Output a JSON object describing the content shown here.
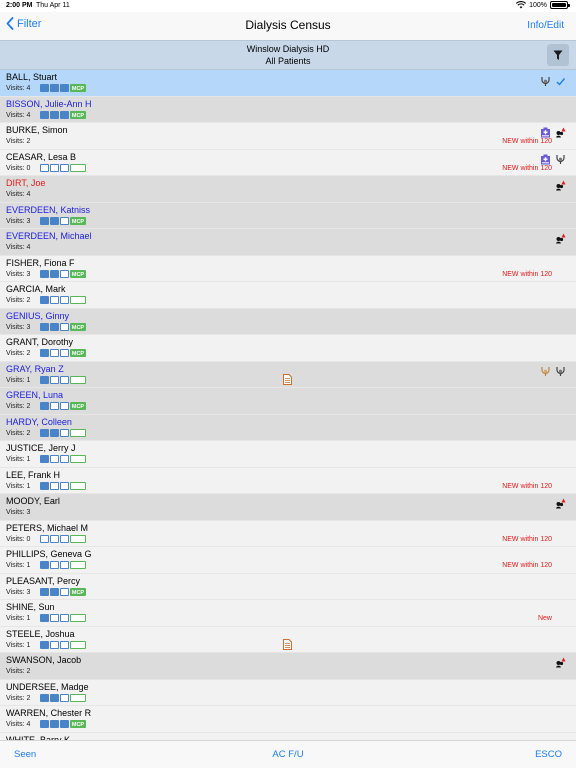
{
  "status_bar": {
    "time": "2:00 PM",
    "date": "Thu Apr 11",
    "battery": "100%"
  },
  "nav": {
    "back_label": "Filter",
    "title": "Dialysis Census",
    "right_label": "Info/Edit"
  },
  "header": {
    "facility": "Winslow Dialysis HD",
    "subtitle": "All Patients"
  },
  "patients": [
    {
      "name": "BALL, Stuart",
      "visits": "Visits: 4",
      "color": "c-black",
      "bg": "selected",
      "boxes": [
        1,
        1,
        1
      ],
      "mcp": "filled",
      "note": "",
      "doc": false,
      "icons": [
        "stethoscope-icon",
        "checkmark-icon"
      ]
    },
    {
      "name": "BISSON, Julie-Ann H",
      "visits": "Visits: 4",
      "color": "c-blue",
      "bg": "shaded",
      "boxes": [
        1,
        1,
        1
      ],
      "mcp": "filled",
      "note": "",
      "doc": false,
      "icons": []
    },
    {
      "name": "BURKE, Simon",
      "visits": "Visits: 2",
      "color": "c-black",
      "bg": "light",
      "boxes": null,
      "mcp": null,
      "note": "NEW within 120",
      "doc": false,
      "icons": [
        "hospital-icon",
        "alert-person-icon"
      ]
    },
    {
      "name": "CEASAR, Lesa B",
      "visits": "Visits: 0",
      "color": "c-black",
      "bg": "light",
      "boxes": [
        0,
        0,
        0
      ],
      "mcp": "empty",
      "note": "NEW within 120",
      "doc": false,
      "icons": [
        "hospital-icon",
        "stethoscope-icon"
      ]
    },
    {
      "name": "DIRT, Joe",
      "visits": "Visits: 4",
      "color": "c-red",
      "bg": "shaded",
      "boxes": null,
      "mcp": null,
      "note": "",
      "doc": false,
      "icons": [
        "alert-person-icon"
      ]
    },
    {
      "name": "EVERDEEN, Katniss",
      "visits": "Visits: 3",
      "color": "c-blue",
      "bg": "shaded",
      "boxes": [
        1,
        1,
        0
      ],
      "mcp": "filled",
      "note": "",
      "doc": false,
      "icons": []
    },
    {
      "name": "EVERDEEN, Michael",
      "visits": "Visits: 4",
      "color": "c-blue",
      "bg": "shaded",
      "boxes": null,
      "mcp": null,
      "note": "",
      "doc": false,
      "icons": [
        "alert-person-icon"
      ]
    },
    {
      "name": "FISHER, Fiona F",
      "visits": "Visits: 3",
      "color": "c-black",
      "bg": "light",
      "boxes": [
        1,
        1,
        0
      ],
      "mcp": "filled",
      "note": "NEW within 120",
      "doc": false,
      "icons": []
    },
    {
      "name": "GARCIA, Mark",
      "visits": "Visits: 2",
      "color": "c-black",
      "bg": "light",
      "boxes": [
        1,
        0,
        0
      ],
      "mcp": "empty",
      "note": "",
      "doc": false,
      "icons": []
    },
    {
      "name": "GENIUS, Ginny",
      "visits": "Visits: 3",
      "color": "c-blue",
      "bg": "shaded",
      "boxes": [
        1,
        1,
        0
      ],
      "mcp": "filled",
      "note": "",
      "doc": false,
      "icons": []
    },
    {
      "name": "GRANT, Dorothy",
      "visits": "Visits: 2",
      "color": "c-black",
      "bg": "light",
      "boxes": [
        1,
        0,
        0
      ],
      "mcp": "filled",
      "note": "",
      "doc": false,
      "icons": []
    },
    {
      "name": "GRAY, Ryan Z",
      "visits": "Visits: 1",
      "color": "c-blue",
      "bg": "shaded",
      "boxes": [
        1,
        0,
        0
      ],
      "mcp": "empty",
      "note": "",
      "doc": true,
      "icons": [
        "stethoscope-gold-icon",
        "stethoscope-icon"
      ]
    },
    {
      "name": "GREEN, Luna",
      "visits": "Visits: 2",
      "color": "c-blue",
      "bg": "shaded",
      "boxes": [
        1,
        0,
        0
      ],
      "mcp": "filled",
      "note": "",
      "doc": false,
      "icons": []
    },
    {
      "name": "HARDY, Colleen",
      "visits": "Visits: 2",
      "color": "c-blue",
      "bg": "shaded",
      "boxes": [
        1,
        1,
        0
      ],
      "mcp": "empty",
      "note": "",
      "doc": false,
      "icons": []
    },
    {
      "name": "JUSTICE, Jerry J",
      "visits": "Visits: 1",
      "color": "c-black",
      "bg": "light",
      "boxes": [
        1,
        0,
        0
      ],
      "mcp": "empty",
      "note": "",
      "doc": false,
      "icons": []
    },
    {
      "name": "LEE, Frank H",
      "visits": "Visits: 1",
      "color": "c-black",
      "bg": "light",
      "boxes": [
        1,
        0,
        0
      ],
      "mcp": "empty",
      "note": "NEW within 120",
      "doc": false,
      "icons": []
    },
    {
      "name": "MOODY, Earl",
      "visits": "Visits: 3",
      "color": "c-black",
      "bg": "shaded",
      "boxes": null,
      "mcp": null,
      "note": "",
      "doc": false,
      "icons": [
        "alert-person-icon"
      ]
    },
    {
      "name": "PETERS, Michael M",
      "visits": "Visits: 0",
      "color": "c-black",
      "bg": "light",
      "boxes": [
        0,
        0,
        0
      ],
      "mcp": "empty",
      "note": "NEW within 120",
      "doc": false,
      "icons": []
    },
    {
      "name": "PHILLIPS, Geneva G",
      "visits": "Visits: 1",
      "color": "c-black",
      "bg": "light",
      "boxes": [
        1,
        0,
        0
      ],
      "mcp": "empty",
      "note": "NEW within 120",
      "doc": false,
      "icons": []
    },
    {
      "name": "PLEASANT, Percy",
      "visits": "Visits: 3",
      "color": "c-black",
      "bg": "light",
      "boxes": [
        1,
        1,
        0
      ],
      "mcp": "filled",
      "note": "",
      "doc": false,
      "icons": []
    },
    {
      "name": "SHINE, Sun",
      "visits": "Visits: 1",
      "color": "c-black",
      "bg": "light",
      "boxes": [
        1,
        0,
        0
      ],
      "mcp": "empty",
      "note": "New",
      "doc": false,
      "icons": []
    },
    {
      "name": "STEELE, Joshua",
      "visits": "Visits: 1",
      "color": "c-black",
      "bg": "light",
      "boxes": [
        1,
        0,
        0
      ],
      "mcp": "empty",
      "note": "",
      "doc": true,
      "icons": []
    },
    {
      "name": "SWANSON, Jacob",
      "visits": "Visits: 2",
      "color": "c-black",
      "bg": "shaded",
      "boxes": null,
      "mcp": null,
      "note": "",
      "doc": false,
      "icons": [
        "alert-person-icon"
      ]
    },
    {
      "name": "UNDERSEE, Madge",
      "visits": "Visits: 2",
      "color": "c-black",
      "bg": "light",
      "boxes": [
        1,
        1,
        0
      ],
      "mcp": "empty",
      "note": "",
      "doc": false,
      "icons": []
    },
    {
      "name": "WARREN, Chester R",
      "visits": "Visits: 4",
      "color": "c-black",
      "bg": "light",
      "boxes": [
        1,
        1,
        1
      ],
      "mcp": "filled",
      "note": "",
      "doc": false,
      "icons": []
    },
    {
      "name": "WHITE, Barry K",
      "visits": "",
      "color": "c-black",
      "bg": "light",
      "boxes": null,
      "mcp": null,
      "note": "",
      "doc": false,
      "icons": []
    }
  ],
  "mcp_label": "MCP",
  "toolbar": {
    "seen": "Seen",
    "ac_fu": "AC F/U",
    "esco": "ESCO"
  },
  "colors": {
    "accent": "#1e7cf2",
    "blue_name": "#1a1ae6",
    "red": "#e61a1a",
    "box": "#4a84c8",
    "mcp": "#58b858",
    "selected": "#b5d8fa",
    "shaded": "#dcdcdc"
  }
}
